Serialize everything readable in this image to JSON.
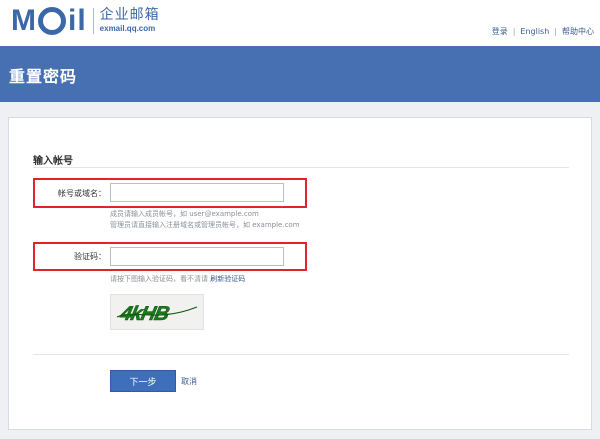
{
  "header": {
    "logo": {
      "brand": "M",
      "brand_tail": "il",
      "product_name": "企业邮箱",
      "url": "exmail.qq.com"
    },
    "links": {
      "login": "登录",
      "english": "English",
      "help": "帮助中心",
      "separator": "|"
    }
  },
  "banner": {
    "title": "重置密码"
  },
  "form": {
    "section_title": "输入帐号",
    "account": {
      "label": "帐号或域名：",
      "value": "",
      "placeholder": "",
      "hint_line1": "成员请输入成员帐号，如 user@example.com",
      "hint_line2": "管理员请直接输入注册域名或管理员帐号，如 example.com"
    },
    "captcha": {
      "label": "验证码：",
      "value": "",
      "placeholder": "",
      "hint": "请按下图输入验证码，看不清请",
      "refresh_label": "刷新验证码",
      "image_text": "4kHB"
    },
    "next_button": "下一步",
    "cancel_link": "取消"
  },
  "colors": {
    "brand_blue": "#3a68a8",
    "banner_bg": "#4670b1",
    "button_bg": "#3f6fbb",
    "highlight_red": "#e0252a",
    "page_bg": "#eef0f3"
  },
  "icons": {
    "captcha_image": "captcha-image"
  }
}
